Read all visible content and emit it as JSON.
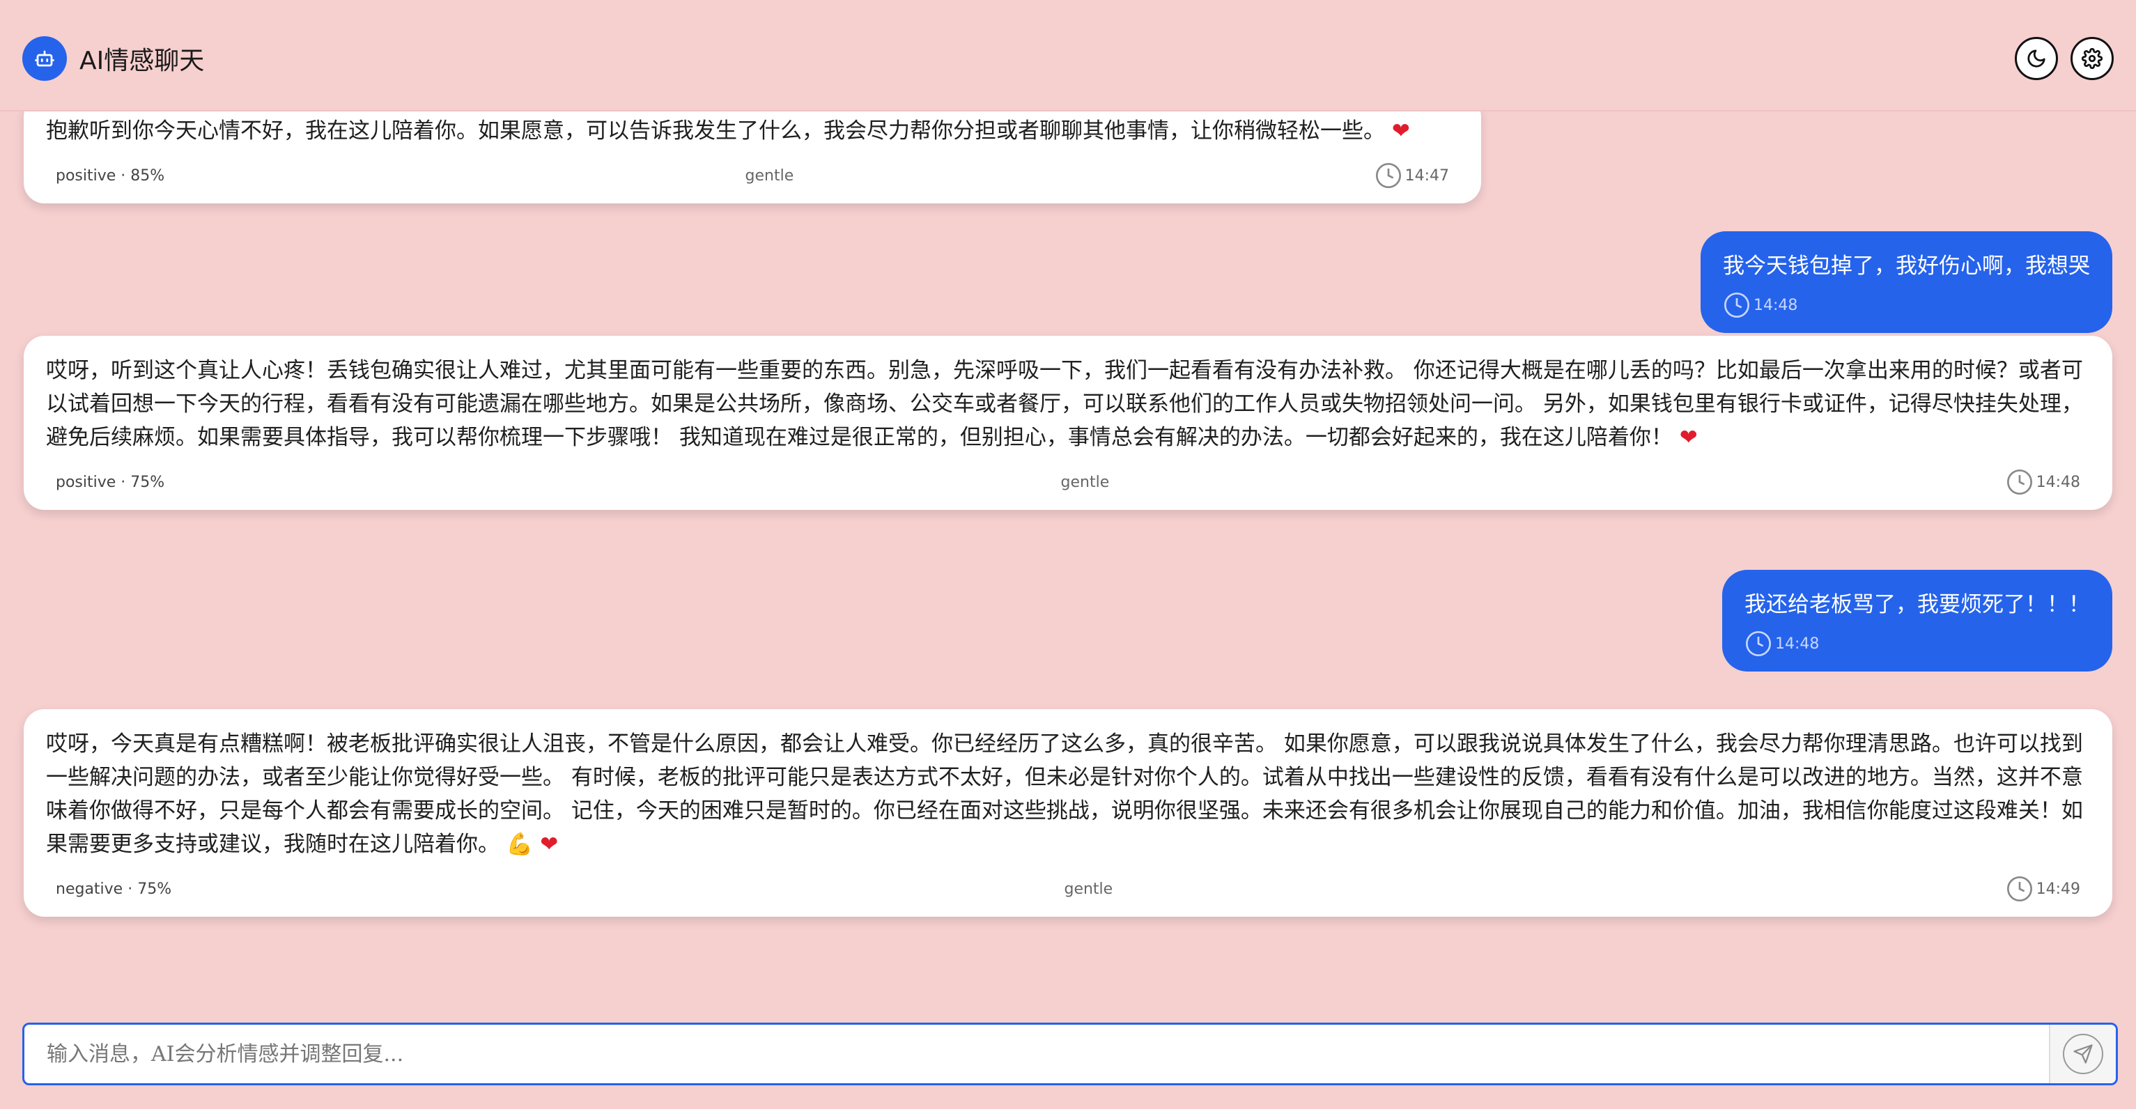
{
  "header": {
    "title": "AI情感聊天",
    "theme_icon": "moon-icon",
    "settings_icon": "gear-icon",
    "logo_icon": "robot-icon"
  },
  "messages": [
    {
      "role": "ai",
      "text": "抱歉听到你今天心情不好，我在这儿陪着你。如果愿意，可以告诉我发生了什么，我会尽力帮你分担或者聊聊其他事情，让你稍微轻松一些。",
      "emoji": "❤",
      "sentiment": "positive · 85%",
      "tone": "gentle",
      "time": "14:47"
    },
    {
      "role": "user",
      "text": "我今天钱包掉了，我好伤心啊，我想哭",
      "time": "14:48"
    },
    {
      "role": "ai",
      "text": "哎呀，听到这个真让人心疼！丢钱包确实很让人难过，尤其里面可能有一些重要的东西。别急，先深呼吸一下，我们一起看看有没有办法补救。 你还记得大概是在哪儿丢的吗？比如最后一次拿出来用的时候？或者可以试着回想一下今天的行程，看看有没有可能遗漏在哪些地方。如果是公共场所，像商场、公交车或者餐厅，可以联系他们的工作人员或失物招领处问一问。 另外，如果钱包里有银行卡或证件，记得尽快挂失处理，避免后续麻烦。如果需要具体指导，我可以帮你梳理一下步骤哦！ 我知道现在难过是很正常的，但别担心，事情总会有解决的办法。一切都会好起来的，我在这儿陪着你！",
      "emoji": "❤",
      "sentiment": "positive · 75%",
      "tone": "gentle",
      "time": "14:48"
    },
    {
      "role": "user",
      "text": "我还给老板骂了，我要烦死了！！！",
      "time": "14:48"
    },
    {
      "role": "ai",
      "text": "哎呀，今天真是有点糟糕啊！被老板批评确实很让人沮丧，不管是什么原因，都会让人难受。你已经经历了这么多，真的很辛苦。 如果你愿意，可以跟我说说具体发生了什么，我会尽力帮你理清思路。也许可以找到一些解决问题的办法，或者至少能让你觉得好受一些。 有时候，老板的批评可能只是表达方式不太好，但未必是针对你个人的。试着从中找出一些建设性的反馈，看看有没有什么是可以改进的地方。当然，这并不意味着你做得不好，只是每个人都会有需要成长的空间。 记住，今天的困难只是暂时的。你已经在面对这些挑战，说明你很坚强。未来还会有很多机会让你展现自己的能力和价值。加油，我相信你能度过这段难关！如果需要更多支持或建议，我随时在这儿陪着你。",
      "emoji": "💪 ❤",
      "sentiment": "negative · 75%",
      "tone": "gentle",
      "time": "14:49"
    }
  ],
  "input": {
    "placeholder": "输入消息，AI会分析情感并调整回复...",
    "value": ""
  },
  "colors": {
    "background": "#f6cfcf",
    "accent": "#2563eb",
    "heart": "#e11d2d"
  }
}
